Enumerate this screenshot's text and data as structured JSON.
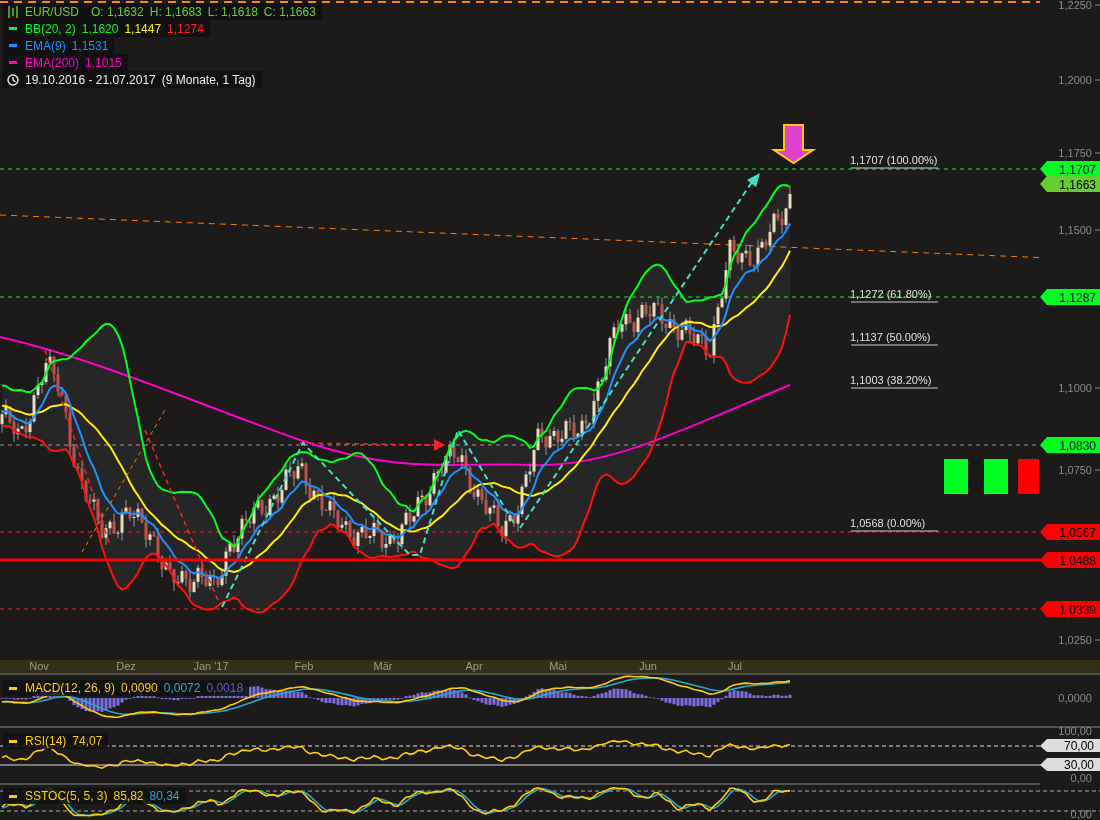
{
  "legend": {
    "symbol": "EUR/USD",
    "color": "#66cc33",
    "ohlc": [
      {
        "label": "O:",
        "value": "1,1632"
      },
      {
        "label": "H:",
        "value": "1,1683"
      },
      {
        "label": "L:",
        "value": "1,1618"
      },
      {
        "label": "C:",
        "value": "1,1663"
      }
    ],
    "indicators": [
      {
        "name": "BB(20, 2)",
        "color": "#00ff22",
        "values": [
          {
            "text": "1,1620",
            "color": "#00ff22"
          },
          {
            "text": "1,1447",
            "color": "#ffee00"
          },
          {
            "text": "1,1274",
            "color": "#ff2020"
          }
        ]
      },
      {
        "name": "EMA(9)",
        "color": "#1e90ff",
        "values": [
          {
            "text": "1,1531",
            "color": "#1e90ff"
          }
        ]
      },
      {
        "name": "EMA(200)",
        "color": "#ff00cc",
        "values": [
          {
            "text": "1,1015",
            "color": "#ff00cc"
          }
        ]
      }
    ],
    "period": {
      "range": "19.10.2016 - 21.07.2017",
      "duration": "(9 Monate, 1 Tag)"
    }
  },
  "price_axis": {
    "ticks": [
      "1,2250",
      "1,2000",
      "1,1750",
      "1,1500",
      "1,1000",
      "1,0750",
      "1,0250"
    ]
  },
  "fib_levels": [
    "1,1707 (100.00%)",
    "1,1272 (61.80%)",
    "1,1137 (50.00%)",
    "1,1003 (38.20%)",
    "1,0568 (0.00%)"
  ],
  "price_tags": [
    {
      "text": "1,1707",
      "color": "#00ff22"
    },
    {
      "text": "1,1663",
      "color": "#66cc33"
    },
    {
      "text": "1,1287",
      "color": "#00ff22"
    },
    {
      "text": "1,0830",
      "color": "#00ff22"
    },
    {
      "text": "1,0567",
      "color": "#ff0000"
    },
    {
      "text": "1,0488",
      "color": "#ff0000"
    },
    {
      "text": "1,0339",
      "color": "#ff0000"
    }
  ],
  "signal_blocks": [
    {
      "color": "#00ff22"
    },
    {
      "color": "#00ff22"
    },
    {
      "color": "#ff0000"
    }
  ],
  "month_axis": [
    "Nov",
    "Dez",
    "Jan '17",
    "Feb",
    "Mär",
    "Apr",
    "Mai",
    "Jun",
    "Jul"
  ],
  "macd": {
    "label": "MACD(12, 26, 9)",
    "values": [
      {
        "text": "0,0090",
        "color": "#ffcc00"
      },
      {
        "text": "0,0072",
        "color": "#22aacc"
      },
      {
        "text": "0,0018",
        "color": "#6655cc"
      }
    ],
    "axis_tick": "0,0000"
  },
  "rsi": {
    "label": "RSI(14)",
    "value": "74,07",
    "ticks": [
      "100,00",
      "0,00"
    ],
    "level_tags": [
      "70,00",
      "30,00"
    ]
  },
  "sstoc": {
    "label": "SSTOC(5, 5, 3)",
    "values": [
      {
        "text": "85,82",
        "color": "#ffcc00"
      },
      {
        "text": "80,34",
        "color": "#22aacc"
      }
    ],
    "ticks": [
      "0,00"
    ]
  }
}
